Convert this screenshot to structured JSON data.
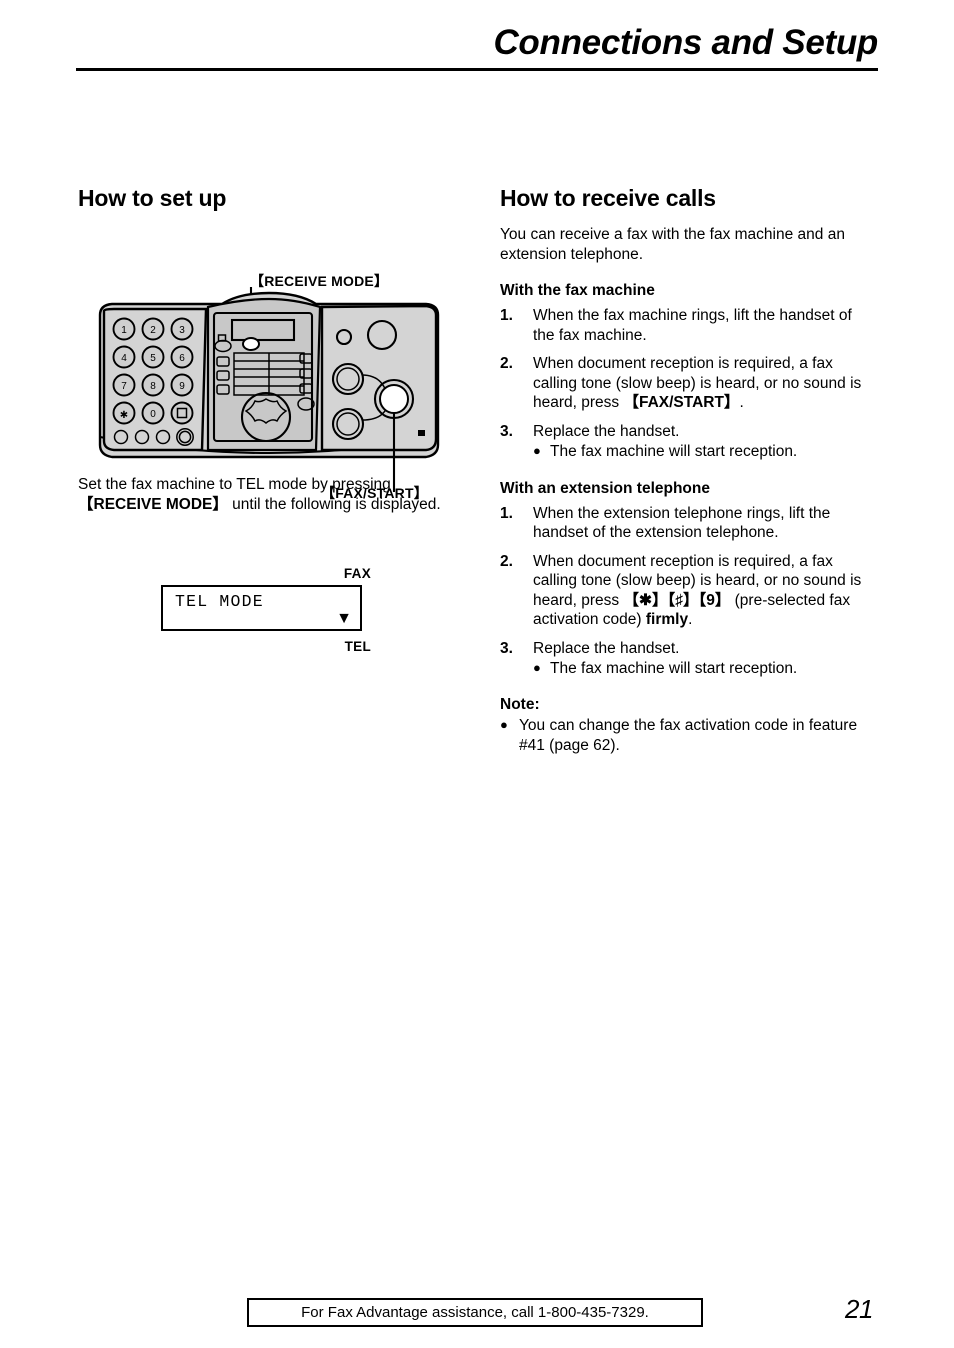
{
  "header": {
    "title": "Connections and Setup"
  },
  "left_column": {
    "heading": "How to set up",
    "diagram": {
      "label_receive_mode": "【RECEIVE MODE】",
      "label_fax_start": "【FAX/START】",
      "keypad_keys": [
        "1",
        "2",
        "3",
        "4",
        "5",
        "6",
        "7",
        "8",
        "9",
        "✱",
        "0",
        "□"
      ]
    },
    "instruction": {
      "part1": "Set the fax machine to TEL mode by pressing ",
      "key": "【RECEIVE MODE】",
      "part2": " until the following is displayed."
    },
    "lcd": {
      "label_top": "FAX",
      "display_text": "TEL MODE",
      "arrow": "▼",
      "label_bottom": "TEL"
    }
  },
  "right_column": {
    "heading": "How to receive calls",
    "intro": "You can receive a fax with the fax machine and an extension telephone.",
    "fax_machine": {
      "subheading": "With the fax machine",
      "steps": [
        {
          "num": "1.",
          "text": "When the fax machine rings, lift the handset of the fax machine."
        },
        {
          "num": "2.",
          "text_before": "When document reception is required, a fax calling tone (slow beep) is heard, or no sound is heard, press ",
          "key": "【FAX/START】",
          "text_after": "."
        },
        {
          "num": "3.",
          "text": "Replace the handset.",
          "bullet": "The fax machine will start reception."
        }
      ]
    },
    "extension_telephone": {
      "subheading": "With an extension telephone",
      "steps": [
        {
          "num": "1.",
          "text": "When the extension telephone rings, lift the handset of the extension telephone."
        },
        {
          "num": "2.",
          "text_before": "When document reception is required, a fax calling tone (slow beep) is heard, or no sound is heard, press ",
          "key": "【✱】【♯】【9】",
          "text_mid": " (pre-selected fax activation code) ",
          "text_bold": "firmly",
          "text_after": "."
        },
        {
          "num": "3.",
          "text": "Replace the handset.",
          "bullet": "The fax machine will start reception."
        }
      ]
    },
    "note": {
      "title": "Note:",
      "items": [
        "You can change the fax activation code in feature #41 (page 62)."
      ]
    }
  },
  "footer": {
    "assistance_text": "For Fax Advantage assistance, call 1-800-435-7329.",
    "page_number": "21"
  },
  "colors": {
    "ink": "#000000",
    "paper": "#ffffff",
    "panel_fill": "#d4d4d4",
    "panel_fill_dark": "#c2c2c2",
    "button_white": "#ffffff"
  }
}
